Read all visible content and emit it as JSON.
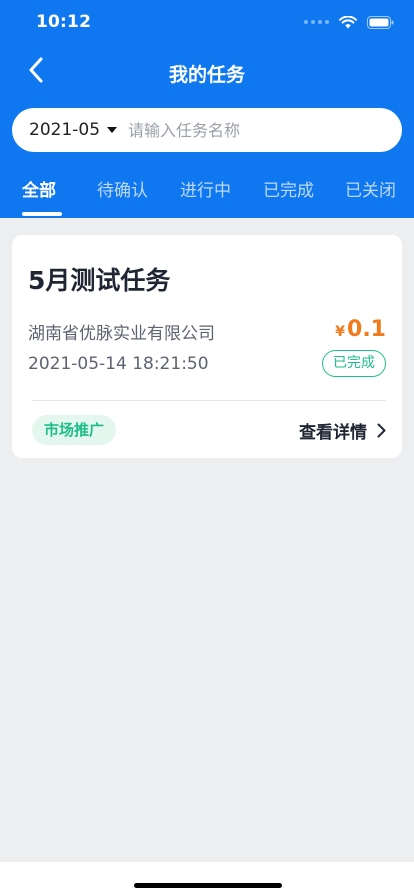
{
  "status_bar": {
    "time": "10:12"
  },
  "nav": {
    "title": "我的任务"
  },
  "search": {
    "month": "2021-05",
    "placeholder": "请输入任务名称"
  },
  "tabs": [
    {
      "label": "全部",
      "active": true
    },
    {
      "label": "待确认",
      "active": false
    },
    {
      "label": "进行中",
      "active": false
    },
    {
      "label": "已完成",
      "active": false
    },
    {
      "label": "已关闭",
      "active": false
    }
  ],
  "task": {
    "title": "5月测试任务",
    "company": "湖南省优脉实业有限公司",
    "price_symbol": "¥",
    "price": "0.1",
    "datetime": "2021-05-14 18:21:50",
    "status": "已完成",
    "tag": "市场推广",
    "detail_label": "查看详情"
  },
  "colors": {
    "header": "#0F78F0",
    "price": "#F07A1C",
    "success": "#1DBE8A",
    "background": "#EDEEF0"
  },
  "icons": {
    "back": "chevron-left-icon",
    "dropdown": "caret-down-icon",
    "detail": "chevron-right-icon"
  }
}
